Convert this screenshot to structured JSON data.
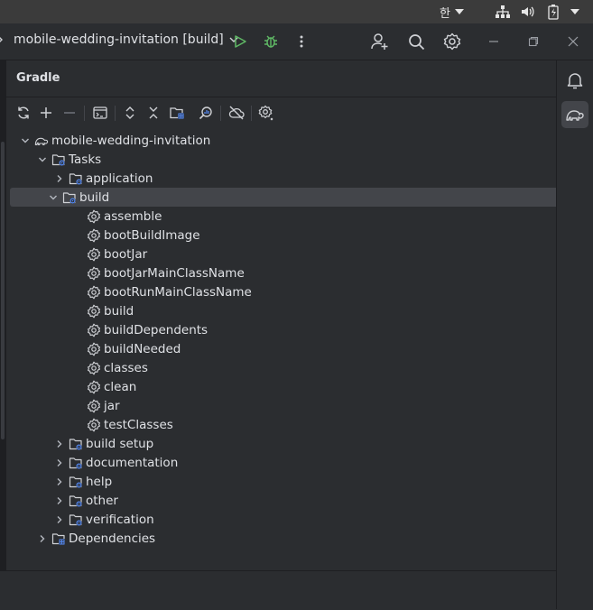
{
  "system_bar": {
    "ime": "한",
    "icons": [
      "network-icon",
      "volume-icon",
      "battery-icon",
      "system-menu-caret-icon"
    ]
  },
  "titlebar": {
    "project_label": "mobile-wedding-invitation [build]"
  },
  "panel": {
    "title": "Gradle",
    "toolbar_icons": [
      "reload-icon",
      "add-icon",
      "remove-icon",
      "execute-task-icon",
      "expand-all-icon",
      "collapse-all-icon",
      "dependencies-icon",
      "analyze-icon",
      "offline-mode-icon",
      "settings-icon"
    ]
  },
  "tree": {
    "root": "mobile-wedding-invitation",
    "tasks": "Tasks",
    "groups": [
      "application",
      "build",
      "build setup",
      "documentation",
      "help",
      "other",
      "verification"
    ],
    "build_tasks": [
      "assemble",
      "bootBuildImage",
      "bootJar",
      "bootJarMainClassName",
      "bootRunMainClassName",
      "build",
      "buildDependents",
      "buildNeeded",
      "classes",
      "clean",
      "jar",
      "testClasses"
    ],
    "dependencies": "Dependencies"
  },
  "colors": {
    "background": "#2b2d30",
    "selection": "#43454a",
    "run": "#5fb865",
    "debug": "#5fb865",
    "folder_badge": "#548af7"
  }
}
